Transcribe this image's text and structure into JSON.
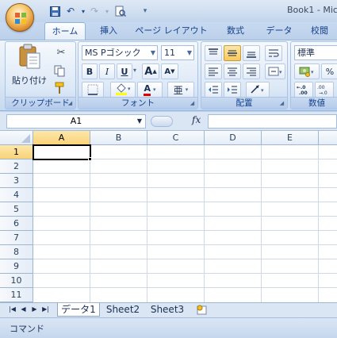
{
  "app": {
    "title": "Book1 - Mic",
    "quick_access": {
      "save_icon": "save-icon",
      "undo_icon": "undo-icon",
      "redo_icon": "redo-icon",
      "print_preview_icon": "print-preview-icon",
      "customize_icon": "customize-qat-icon"
    }
  },
  "ribbon": {
    "tabs": [
      {
        "label": "ホーム",
        "active": true
      },
      {
        "label": "挿入"
      },
      {
        "label": "ページ レイアウト"
      },
      {
        "label": "数式"
      },
      {
        "label": "データ"
      },
      {
        "label": "校閲"
      }
    ],
    "clipboard": {
      "paste_label": "貼り付け",
      "group_label": "クリップボード"
    },
    "font": {
      "font_name": "MS Pゴシック",
      "font_size": "11",
      "bold": "B",
      "italic": "I",
      "underline": "U",
      "grow": "A",
      "shrink": "A",
      "font_color_letter": "A",
      "phonetic": "亜",
      "group_label": "フォント"
    },
    "alignment": {
      "group_label": "配置"
    },
    "number": {
      "format": "標準",
      "percent": "%",
      "dec_inc": ".00",
      "group_label": "数値"
    }
  },
  "formula_bar": {
    "name_box": "A1",
    "fx": "fx",
    "value": ""
  },
  "sheet": {
    "columns": [
      "A",
      "B",
      "C",
      "D",
      "E"
    ],
    "rows": [
      "1",
      "2",
      "3",
      "4",
      "5",
      "6",
      "7",
      "8",
      "9",
      "10",
      "11"
    ],
    "active_cell": "A1"
  },
  "sheet_tabs": [
    {
      "label": "データ1",
      "active": true
    },
    {
      "label": "Sheet2"
    },
    {
      "label": "Sheet3"
    }
  ],
  "status": {
    "mode": "コマンド"
  }
}
